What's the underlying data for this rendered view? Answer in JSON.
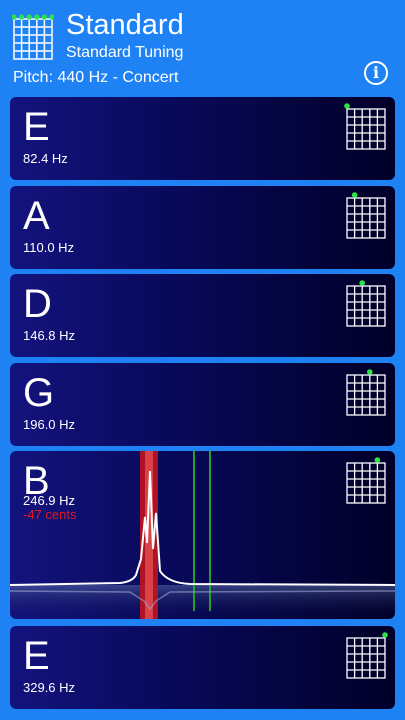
{
  "header": {
    "title": "Standard",
    "subtitle": "Standard Tuning",
    "pitch": "Pitch: 440 Hz - Concert",
    "info_label": "i"
  },
  "strings": [
    {
      "note": "E",
      "freq": "82.4 Hz",
      "string_index": 0
    },
    {
      "note": "A",
      "freq": "110.0 Hz",
      "string_index": 1
    },
    {
      "note": "D",
      "freq": "146.8 Hz",
      "string_index": 2
    },
    {
      "note": "G",
      "freq": "196.0 Hz",
      "string_index": 3
    },
    {
      "note": "B",
      "freq": "246.9 Hz",
      "string_index": 4,
      "cents": "-47 cents",
      "active": true
    },
    {
      "note": "E",
      "freq": "329.6 Hz",
      "string_index": 5
    }
  ],
  "colors": {
    "background": "#1e82f5",
    "dot": "#2ee04a",
    "cents": "#e11b1b",
    "target_line": "#1fa32b"
  }
}
